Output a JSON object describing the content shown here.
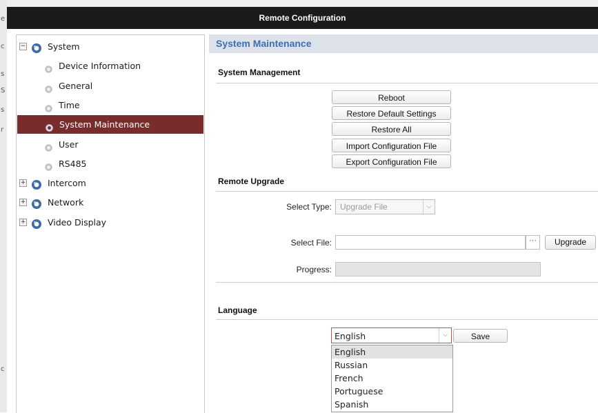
{
  "window": {
    "title": "Remote Configuration"
  },
  "background_chars": [
    "e",
    "c",
    "s",
    "S",
    "s",
    "r",
    "c"
  ],
  "tree": {
    "items": [
      {
        "label": "System",
        "level": 0,
        "toggle": "−",
        "selected": false
      },
      {
        "label": "Device Information",
        "level": 1,
        "selected": false
      },
      {
        "label": "General",
        "level": 1,
        "selected": false
      },
      {
        "label": "Time",
        "level": 1,
        "selected": false
      },
      {
        "label": "System Maintenance",
        "level": 1,
        "selected": true
      },
      {
        "label": "User",
        "level": 1,
        "selected": false
      },
      {
        "label": "RS485",
        "level": 1,
        "selected": false
      },
      {
        "label": "Intercom",
        "level": 0,
        "toggle": "+",
        "selected": false
      },
      {
        "label": "Network",
        "level": 0,
        "toggle": "+",
        "selected": false
      },
      {
        "label": "Video Display",
        "level": 0,
        "toggle": "+",
        "selected": false
      }
    ]
  },
  "page": {
    "title": "System Maintenance"
  },
  "system_management": {
    "title": "System Management",
    "buttons": {
      "reboot": "Reboot",
      "restore_default": "Restore Default Settings",
      "restore_all": "Restore All",
      "import_config": "Import Configuration File",
      "export_config": "Export Configuration File"
    }
  },
  "remote_upgrade": {
    "title": "Remote Upgrade",
    "select_type_label": "Select Type:",
    "select_type_value": "Upgrade File",
    "select_file_label": "Select File:",
    "select_file_value": "",
    "browse_label": "···",
    "upgrade_button": "Upgrade",
    "progress_label": "Progress:",
    "progress_value": 0
  },
  "language": {
    "title": "Language",
    "selected": "English",
    "save_button": "Save",
    "options": [
      "English",
      "Russian",
      "French",
      "Portuguese",
      "Spanish"
    ],
    "highlighted_index": 0
  },
  "colors": {
    "title_bar": "#1b1b1b",
    "selected_item": "#7a2b2b",
    "header_text": "#3d6fae",
    "header_bg": "#dde2ea",
    "dropdown_border_active": "#c0504d"
  }
}
